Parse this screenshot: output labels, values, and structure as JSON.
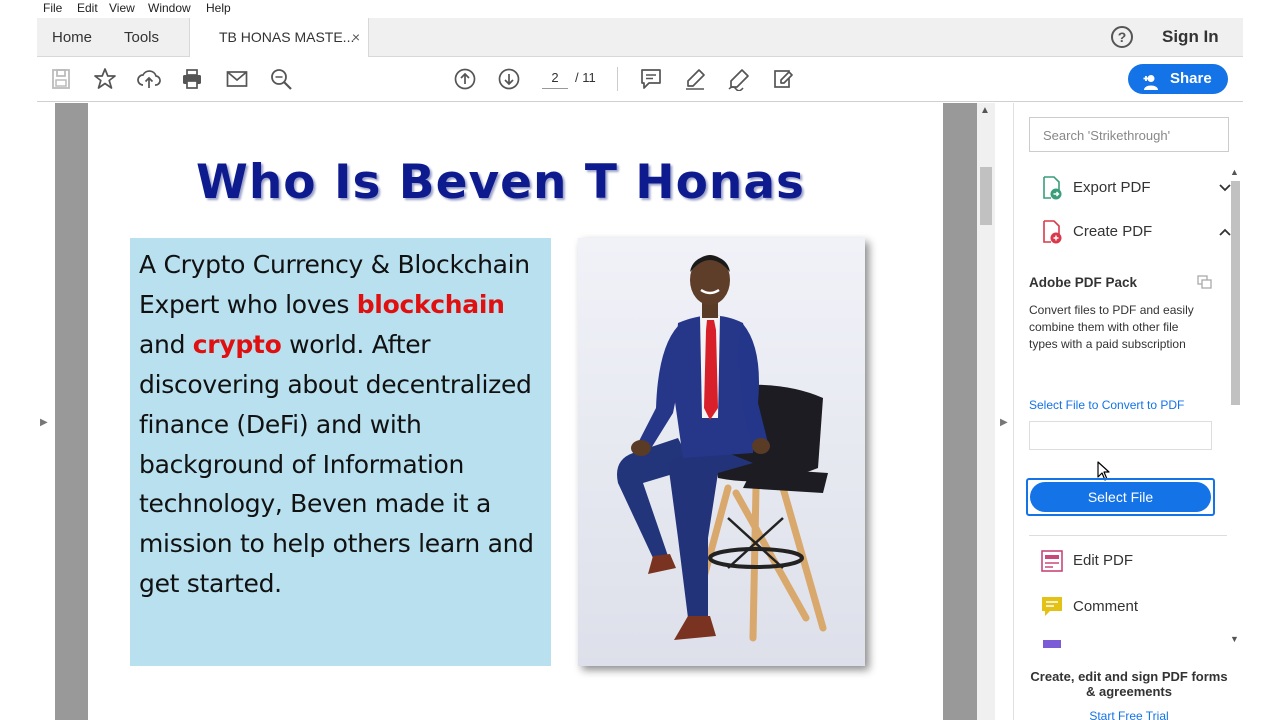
{
  "menu": [
    "File",
    "Edit",
    "View",
    "Window",
    "Help"
  ],
  "tabs": {
    "home": "Home",
    "tools": "Tools",
    "document": "TB HONAS MASTE...",
    "close": "×"
  },
  "header": {
    "help": "?",
    "signin": "Sign In"
  },
  "toolbar": {
    "icons": [
      "save-icon",
      "bookmark-star-icon",
      "upload-cloud-icon",
      "print-icon",
      "email-icon",
      "zoom-search-icon",
      "page-up-icon",
      "page-down-icon",
      "comment-icon",
      "highlight-pen-icon",
      "sign-icon",
      "more-tools-icon"
    ],
    "page_current": "2",
    "page_total": "/ 11",
    "share_label": "Share"
  },
  "document": {
    "title": "Who Is Beven T Honas",
    "bio_part1": "A Crypto Currency & Blockchain Expert who loves ",
    "bio_red1": "blockchain",
    "bio_and": " and ",
    "bio_red2": "crypto",
    "bio_part2": " world. After discovering about decentralized finance (DeFi) and with  background of Information technology, Beven made it a mission to help others learn and get started.",
    "photo_alt": "man-in-blue-suit-photo"
  },
  "right_panel": {
    "search_placeholder": "Search 'Strikethrough'",
    "export_pdf": "Export PDF",
    "create_pdf": "Create PDF",
    "pack_title": "Adobe PDF Pack",
    "pack_desc": "Convert files to PDF and easily combine them with other file types with a paid subscription",
    "select_label": "Select File to Convert to PDF",
    "select_button": "Select File",
    "edit_pdf": "Edit PDF",
    "comment": "Comment",
    "promo_title": "Create, edit and sign PDF forms & agreements",
    "promo_link": "Start Free Trial"
  },
  "colors": {
    "accent": "#1473e6",
    "title_blue": "#0d1b8e",
    "box_bg": "#b8e0ef",
    "highlight_red": "#e01010"
  }
}
